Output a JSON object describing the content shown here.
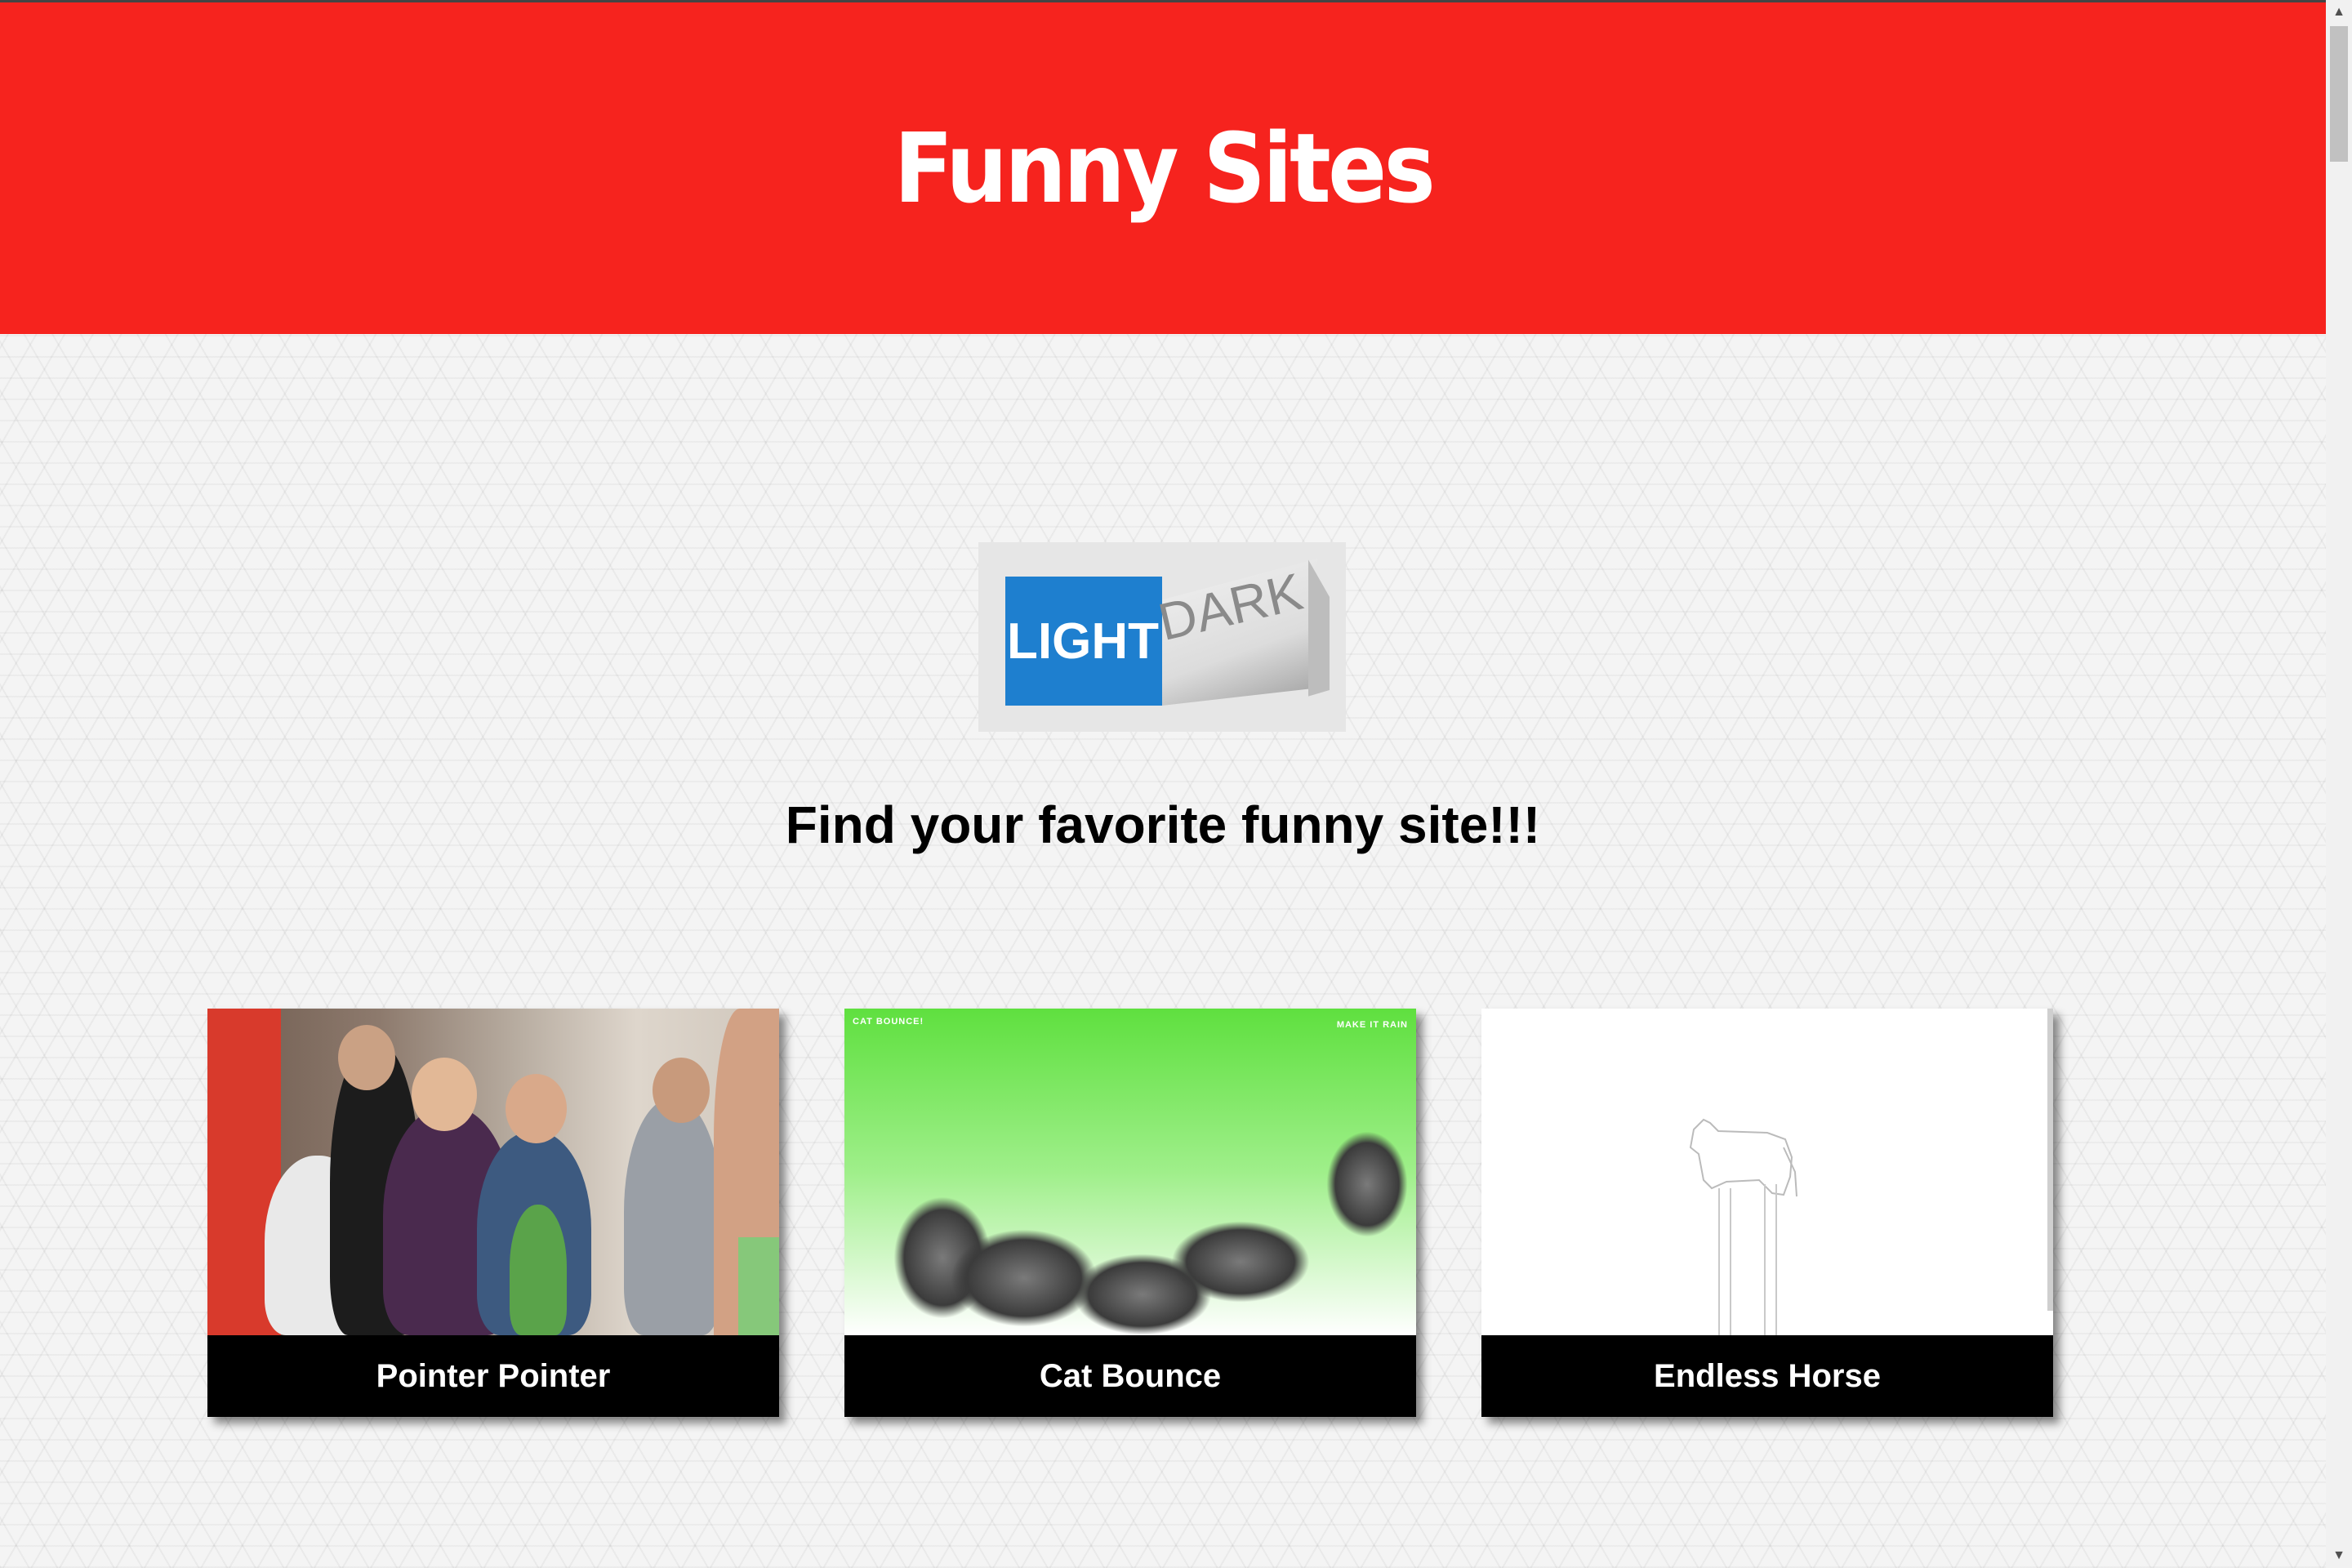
{
  "header": {
    "title": "Funny Sites",
    "background_color": "#f6231e"
  },
  "theme_toggle": {
    "light_label": "LIGHT",
    "dark_label": "DARK",
    "light_color": "#1e7fcf"
  },
  "tagline": "Find your favorite funny site!!!",
  "cards": [
    {
      "label": "Pointer Pointer",
      "thumbnail": "party-photo"
    },
    {
      "label": "Cat Bounce",
      "thumbnail": "cat-bounce-screenshot",
      "thumb_left_text": "CAT BOUNCE!",
      "thumb_right_text": "MAKE IT RAIN"
    },
    {
      "label": "Endless Horse",
      "thumbnail": "endless-horse-screenshot"
    }
  ],
  "scrollbar": {
    "up_icon": "▲",
    "down_icon": "▼"
  }
}
